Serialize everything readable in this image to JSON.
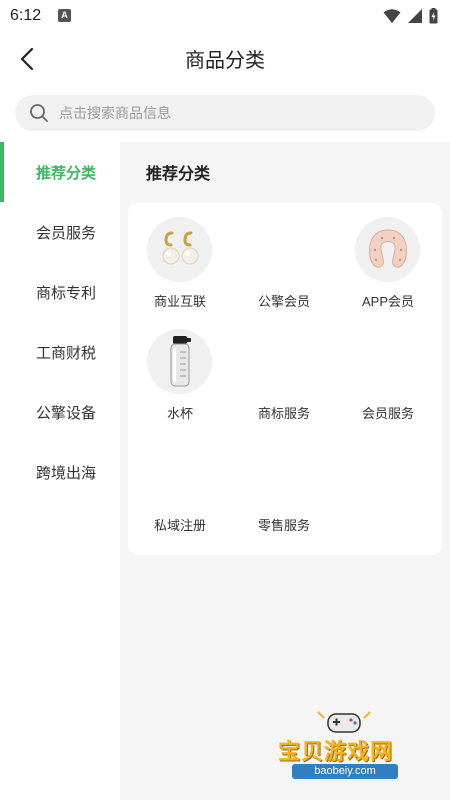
{
  "status": {
    "time": "6:12",
    "notif_letter": "A"
  },
  "header": {
    "title": "商品分类"
  },
  "search": {
    "placeholder": "点击搜索商品信息"
  },
  "sidebar": {
    "items": [
      {
        "label": "推荐分类",
        "active": true
      },
      {
        "label": "会员服务"
      },
      {
        "label": "商标专利"
      },
      {
        "label": "工商财税"
      },
      {
        "label": "公擎设备"
      },
      {
        "label": "跨境出海"
      }
    ]
  },
  "content": {
    "section_title": "推荐分类",
    "items": [
      {
        "label": "商业互联",
        "icon": "pearl-earrings"
      },
      {
        "label": "公擎会员",
        "icon": "none"
      },
      {
        "label": "APP会员",
        "icon": "neck-pillow"
      },
      {
        "label": "水杯",
        "icon": "water-bottle"
      },
      {
        "label": "商标服务",
        "icon": "none"
      },
      {
        "label": "会员服务",
        "icon": "none"
      },
      {
        "label": "私域注册",
        "icon": "none"
      },
      {
        "label": "零售服务",
        "icon": "none"
      }
    ]
  },
  "watermark": {
    "title": "宝贝游戏网",
    "url": "baobeiy.com"
  },
  "colors": {
    "accent": "#3cb860",
    "content_bg": "#f5f5f5",
    "watermark": "#f3b321"
  }
}
